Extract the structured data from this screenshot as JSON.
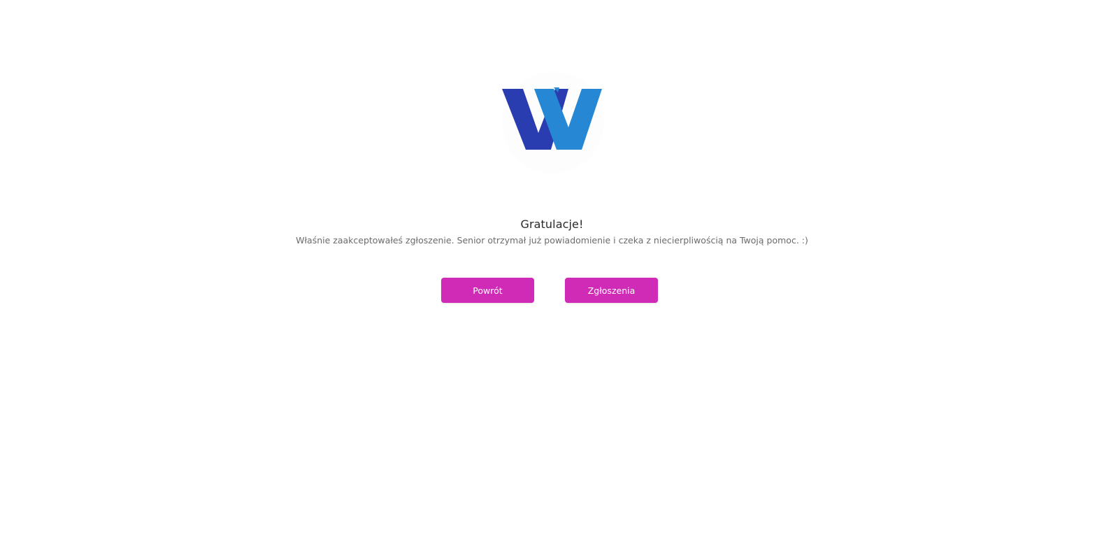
{
  "logo": {
    "name": "w-logo",
    "colors": {
      "dark": "#2a3db0",
      "light": "#2688d4"
    }
  },
  "message": {
    "title": "Gratulacje!",
    "body": "Właśnie zaakceptowałeś zgłoszenie. Senior otrzymał już powiadomienie i czeka z niecierpliwością na Twoją pomoc. :)"
  },
  "actions": {
    "back_label": "Powrót",
    "requests_label": "Zgłoszenia"
  },
  "theme": {
    "accent": "#d02bb7"
  }
}
